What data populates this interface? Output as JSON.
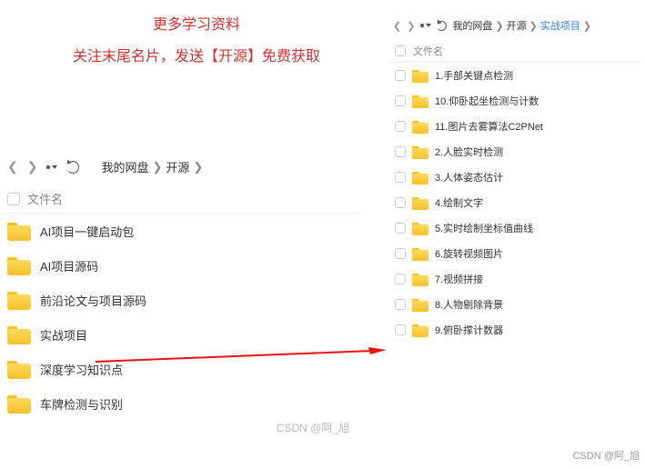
{
  "promo": {
    "line1": "更多学习资料",
    "line2": "关注末尾名片，发送【开源】免费获取"
  },
  "left": {
    "breadcrumb": [
      "我的网盘",
      "开源"
    ],
    "column_header": "文件名",
    "items": [
      "AI项目一键启动包",
      "AI项目源码",
      "前沿论文与项目源码",
      "实战项目",
      "深度学习知识点",
      "车牌检测与识别"
    ]
  },
  "right": {
    "breadcrumb": [
      "我的网盘",
      "开源",
      "实战项目"
    ],
    "column_header": "文件名",
    "items": [
      "1.手部关键点检测",
      "10.仰卧起坐检测与计数",
      "11.图片去雾算法C2PNet",
      "2.人脸实时检测",
      "3.人体姿态估计",
      "4.绘制文字",
      "5.实时绘制坐标值曲线",
      "6.旋转视频图片",
      "7.视频拼接",
      "8.人物剔除背景",
      "9.俯卧撑计数器"
    ]
  },
  "watermark": {
    "left": "CSDN @阿_旭",
    "right": "CSDN @阿_旭"
  }
}
